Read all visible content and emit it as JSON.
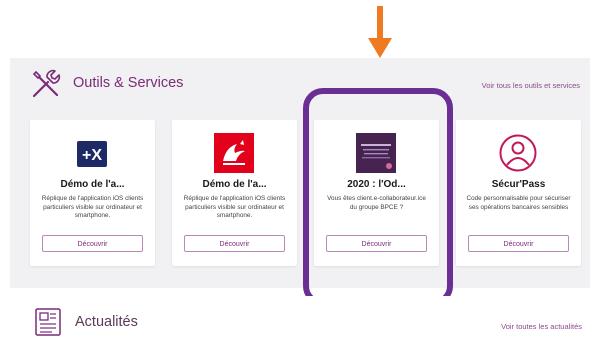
{
  "services": {
    "title": "Outils & Services",
    "see_all": "Voir tous les outils et services",
    "cards": [
      {
        "title": "Démo de l'a...",
        "description": "Réplique de l'application iOS clients particuliers visible sur ordinateur et smartphone.",
        "button": "Découvrir",
        "icon": "plus-x-logo-icon"
      },
      {
        "title": "Démo de l'a...",
        "description": "Réplique de l'application iOS clients particuliers visible sur ordinateur et smartphone.",
        "button": "Découvrir",
        "icon": "squirrel-logo-icon"
      },
      {
        "title": "2020 : l'Od...",
        "description": "Vous êtes client.e-collaborateur.ice du groupe BPCE ?",
        "button": "Découvrir",
        "icon": "decouvrir-thumbnail-icon"
      },
      {
        "title": "Sécur'Pass",
        "description": "Code personnalisable pour sécuriser ses opérations bancaires sensibles",
        "button": "Découvrir",
        "icon": "user-circle-icon"
      }
    ]
  },
  "news": {
    "title": "Actualités",
    "see_all": "Voir toutes les actualités"
  },
  "colors": {
    "accent": "#7a2b79",
    "highlight": "#6a2e94",
    "arrow": "#f07a22",
    "brand_red": "#e3001b",
    "brand_navy": "#1e2a66"
  }
}
